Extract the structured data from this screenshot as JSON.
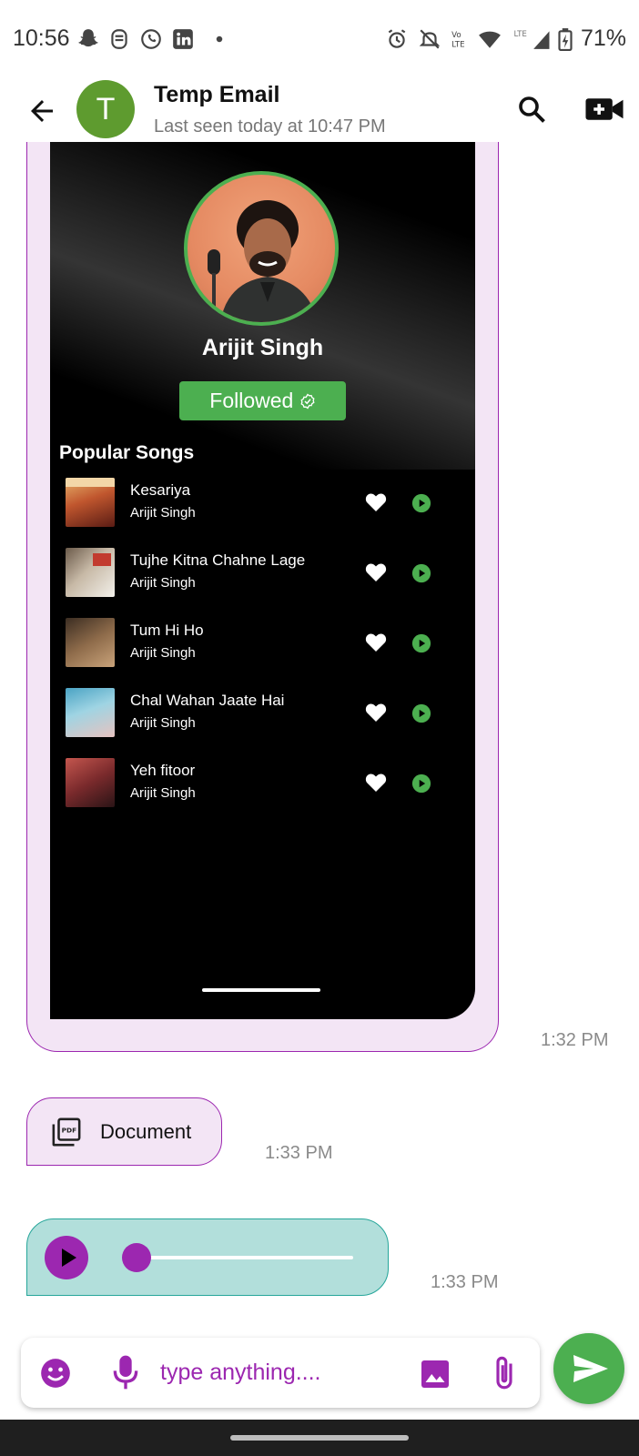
{
  "status_bar": {
    "time": "10:56",
    "battery_percent": "71%",
    "icons": [
      "snapchat-icon",
      "notification-icon",
      "whatsapp-icon",
      "linkedin-icon",
      "dot-icon",
      "alarm-icon",
      "bell-off-icon",
      "volte-icon",
      "wifi-icon",
      "lte-signal-icon",
      "battery-charging-icon"
    ]
  },
  "app_bar": {
    "avatar_letter": "T",
    "contact_name": "Temp Email",
    "last_seen": "Last seen today at 10:47 PM",
    "colors": {
      "avatar": "#5e9b2f"
    }
  },
  "messages": {
    "image_message": {
      "artist_name": "Arijit Singh",
      "follow_label": "Followed",
      "popular_heading": "Popular Songs",
      "songs": [
        {
          "title": "Kesariya",
          "artist": "Arijit Singh"
        },
        {
          "title": "Tujhe Kitna Chahne Lage",
          "artist": "Arijit Singh"
        },
        {
          "title": "Tum Hi Ho",
          "artist": "Arijit Singh"
        },
        {
          "title": "Chal Wahan Jaate Hai",
          "artist": "Arijit Singh"
        },
        {
          "title": "Yeh fitoor",
          "artist": "Arijit Singh"
        }
      ],
      "timestamp": "1:32 PM"
    },
    "document_message": {
      "label": "Document",
      "timestamp": "1:33 PM"
    },
    "audio_message": {
      "progress": 0.0,
      "timestamp": "1:33 PM"
    }
  },
  "composer": {
    "placeholder": "type anything...."
  },
  "colors": {
    "accent_purple": "#9c27b0",
    "bubble_purple_bg": "#f3e5f5",
    "audio_bubble_bg": "#b2dfdb",
    "send_green": "#4caf50"
  }
}
